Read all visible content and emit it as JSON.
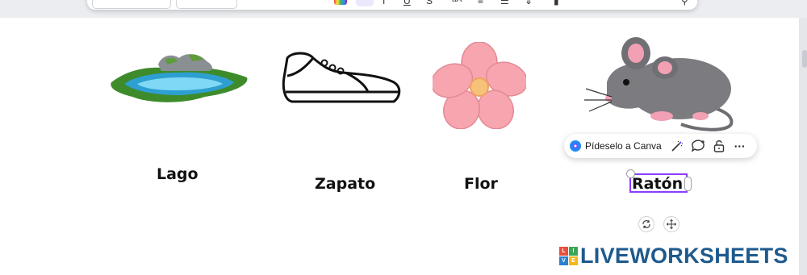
{
  "toolbar": {
    "font_field_icon": "font-size-field",
    "active_tool": "text-color"
  },
  "cards": [
    {
      "word": "Lago",
      "icon": "lake-icon"
    },
    {
      "word": "Zapato",
      "icon": "shoe-icon"
    },
    {
      "word": "Flor",
      "icon": "flower-icon"
    },
    {
      "word": "Ratón",
      "icon": "mouse-icon"
    }
  ],
  "context_menu": {
    "ask_canva_label": "Pídeselo a Canva",
    "more_label": "···"
  },
  "brand": {
    "blocks": [
      "L",
      "I",
      "V",
      "E"
    ],
    "text": "LIVEWORKSHEETS",
    "colors": {
      "text": "#1e5a8e",
      "block1": "#e94e3c",
      "block2": "#3aa655",
      "block3": "#2a7fd1",
      "block4": "#f6b71e"
    }
  },
  "colors": {
    "accent": "#8b3dff",
    "canva_blue": "#1d8cf8"
  }
}
